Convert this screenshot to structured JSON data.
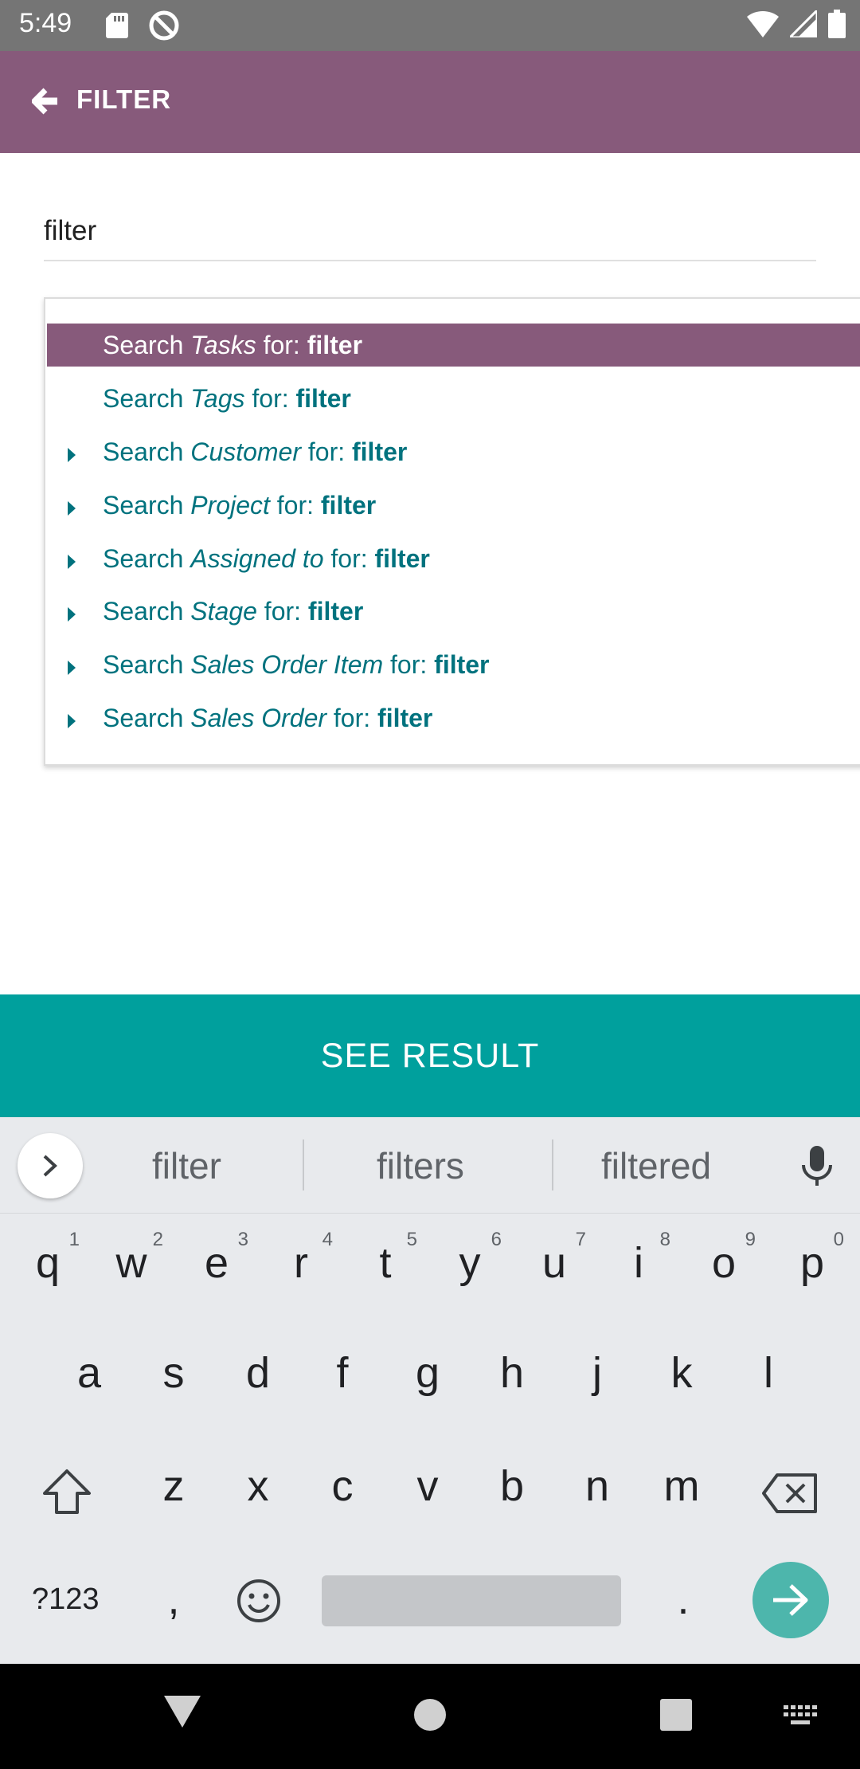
{
  "status_bar": {
    "time": "5:49"
  },
  "app_bar": {
    "title": "FILTER"
  },
  "search": {
    "value": "filter"
  },
  "dropdown": {
    "items": [
      {
        "prefix": "Search ",
        "field": "Tasks",
        "mid": " for: ",
        "query": "filter",
        "active": true,
        "expandable": false
      },
      {
        "prefix": "Search ",
        "field": "Tags",
        "mid": " for: ",
        "query": "filter",
        "active": false,
        "expandable": false
      },
      {
        "prefix": "Search ",
        "field": "Customer",
        "mid": " for: ",
        "query": "filter",
        "active": false,
        "expandable": true
      },
      {
        "prefix": "Search ",
        "field": "Project",
        "mid": " for: ",
        "query": "filter",
        "active": false,
        "expandable": true
      },
      {
        "prefix": "Search ",
        "field": "Assigned to",
        "mid": " for: ",
        "query": "filter",
        "active": false,
        "expandable": true
      },
      {
        "prefix": "Search ",
        "field": "Stage",
        "mid": " for: ",
        "query": "filter",
        "active": false,
        "expandable": true
      },
      {
        "prefix": "Search ",
        "field": "Sales Order Item",
        "mid": " for: ",
        "query": "filter",
        "active": false,
        "expandable": true
      },
      {
        "prefix": "Search ",
        "field": "Sales Order",
        "mid": " for: ",
        "query": "filter",
        "active": false,
        "expandable": true
      }
    ]
  },
  "see_result": {
    "label": "SEE RESULT"
  },
  "keyboard": {
    "suggestions": [
      "filter",
      "filters",
      "filtered"
    ],
    "row1": [
      {
        "k": "q",
        "n": "1"
      },
      {
        "k": "w",
        "n": "2"
      },
      {
        "k": "e",
        "n": "3"
      },
      {
        "k": "r",
        "n": "4"
      },
      {
        "k": "t",
        "n": "5"
      },
      {
        "k": "y",
        "n": "6"
      },
      {
        "k": "u",
        "n": "7"
      },
      {
        "k": "i",
        "n": "8"
      },
      {
        "k": "o",
        "n": "9"
      },
      {
        "k": "p",
        "n": "0"
      }
    ],
    "row2": [
      "a",
      "s",
      "d",
      "f",
      "g",
      "h",
      "j",
      "k",
      "l"
    ],
    "row3": [
      "z",
      "x",
      "c",
      "v",
      "b",
      "n",
      "m"
    ],
    "symbols_label": "?123",
    "comma": ",",
    "period": "."
  },
  "colors": {
    "app_bar": "#875a7b",
    "accent": "#00a09d",
    "link_teal": "#00727e"
  }
}
